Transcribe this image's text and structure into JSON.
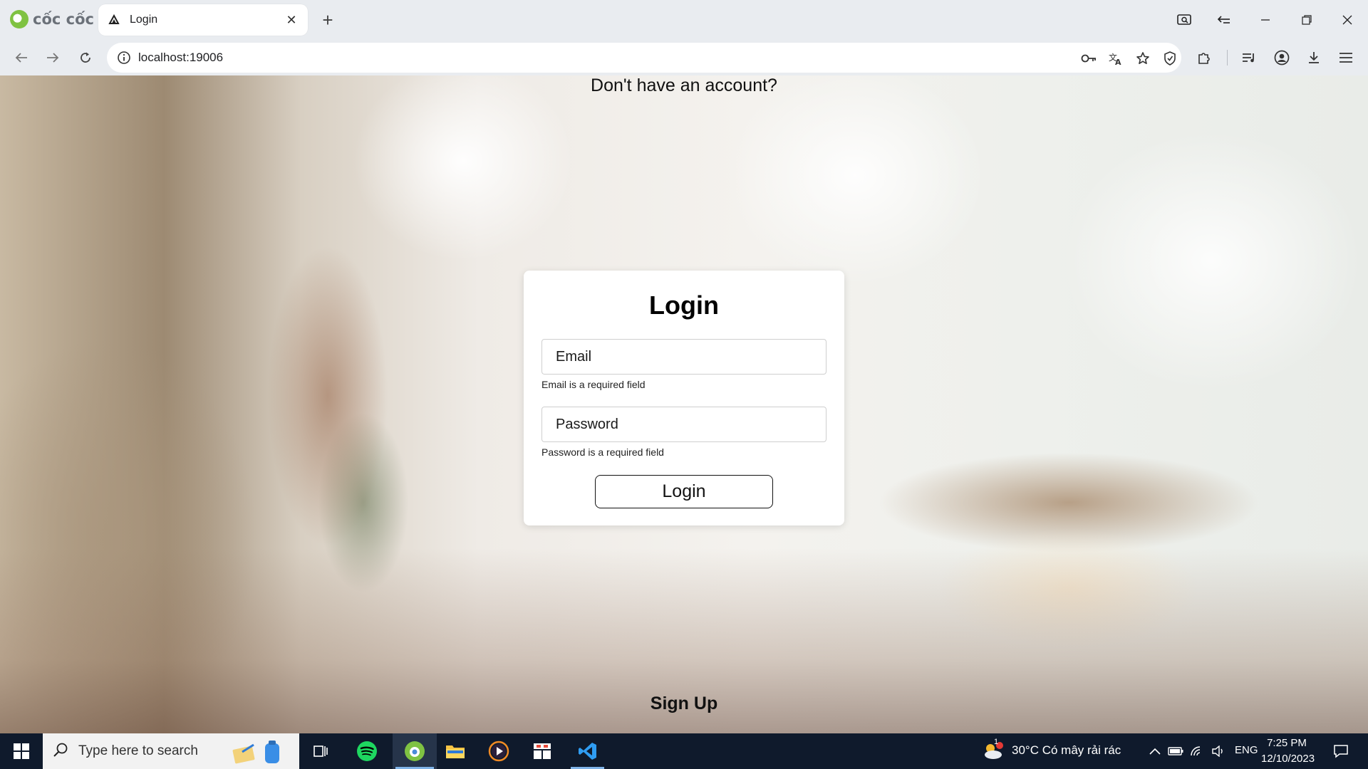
{
  "browser": {
    "brand": "cốc cốc",
    "tab": {
      "title": "Login"
    },
    "url": "localhost:19006"
  },
  "login": {
    "title": "Login",
    "email_placeholder": "Email",
    "email_error": "Email is a required field",
    "password_placeholder": "Password",
    "password_error": "Password is a required field",
    "submit_label": "Login",
    "signup_prompt": "Don't have an account?",
    "signup_label": "Sign Up"
  },
  "taskbar": {
    "search_placeholder": "Type here to search",
    "weather": "30°C  Có mây rải rác",
    "weather_badge": "1",
    "language": "ENG",
    "time": "7:25 PM",
    "date": "12/10/2023"
  },
  "colors": {
    "taskbar_bg": "#0f1a2c",
    "chrome_bg": "#e9ecf0",
    "card_bg": "#ffffff"
  }
}
